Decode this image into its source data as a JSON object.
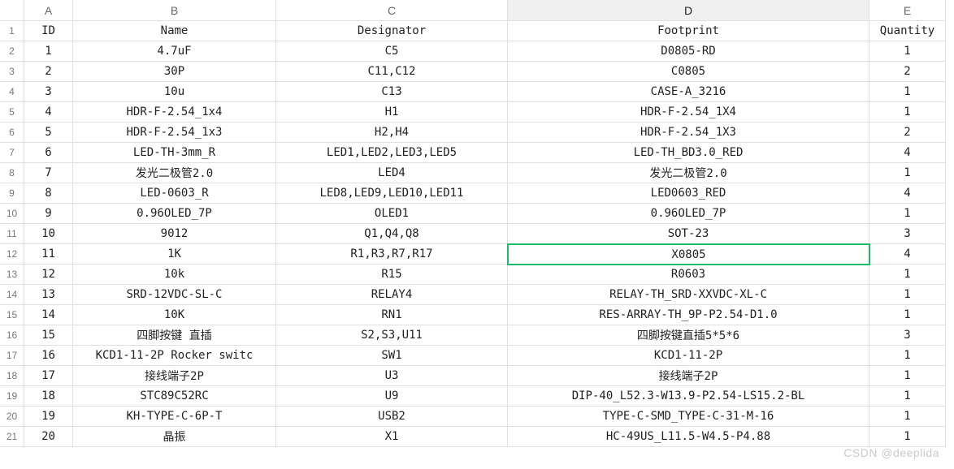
{
  "columns": [
    "A",
    "B",
    "C",
    "D",
    "E"
  ],
  "selectedColumn": "D",
  "activeCell": {
    "row": 11,
    "col": "D"
  },
  "headerRowIndex": 1,
  "headers": {
    "A": "ID",
    "B": "Name",
    "C": "Designator",
    "D": "Footprint",
    "E": "Quantity"
  },
  "rows": [
    {
      "id": "1",
      "name": "4.7uF",
      "designator": "C5",
      "footprint": "D0805-RD",
      "qty": "1"
    },
    {
      "id": "2",
      "name": "30P",
      "designator": "C11,C12",
      "footprint": "C0805",
      "qty": "2"
    },
    {
      "id": "3",
      "name": "10u",
      "designator": "C13",
      "footprint": "CASE-A_3216",
      "qty": "1"
    },
    {
      "id": "4",
      "name": "HDR-F-2.54_1x4",
      "designator": "H1",
      "footprint": "HDR-F-2.54_1X4",
      "qty": "1"
    },
    {
      "id": "5",
      "name": "HDR-F-2.54_1x3",
      "designator": "H2,H4",
      "footprint": "HDR-F-2.54_1X3",
      "qty": "2"
    },
    {
      "id": "6",
      "name": "LED-TH-3mm_R",
      "designator": "LED1,LED2,LED3,LED5",
      "footprint": "LED-TH_BD3.0_RED",
      "qty": "4"
    },
    {
      "id": "7",
      "name": "发光二极管2.0",
      "designator": "LED4",
      "footprint": "发光二极管2.0",
      "qty": "1"
    },
    {
      "id": "8",
      "name": "LED-0603_R",
      "designator": "LED8,LED9,LED10,LED11",
      "footprint": "LED0603_RED",
      "qty": "4"
    },
    {
      "id": "9",
      "name": "0.96OLED_7P",
      "designator": "OLED1",
      "footprint": "0.96OLED_7P",
      "qty": "1"
    },
    {
      "id": "10",
      "name": "9012",
      "designator": "Q1,Q4,Q8",
      "footprint": "SOT-23",
      "qty": "3"
    },
    {
      "id": "11",
      "name": "1K",
      "designator": "R1,R3,R7,R17",
      "footprint": "X0805",
      "qty": "4"
    },
    {
      "id": "12",
      "name": "10k",
      "designator": "R15",
      "footprint": "R0603",
      "qty": "1"
    },
    {
      "id": "13",
      "name": "SRD-12VDC-SL-C",
      "designator": "RELAY4",
      "footprint": "RELAY-TH_SRD-XXVDC-XL-C",
      "qty": "1"
    },
    {
      "id": "14",
      "name": "10K",
      "designator": "RN1",
      "footprint": "RES-ARRAY-TH_9P-P2.54-D1.0",
      "qty": "1"
    },
    {
      "id": "15",
      "name": "四脚按键 直插",
      "designator": "S2,S3,U11",
      "footprint": "四脚按键直插5*5*6",
      "qty": "3"
    },
    {
      "id": "16",
      "name": "KCD1-11-2P Rocker switc",
      "designator": "SW1",
      "footprint": "KCD1-11-2P",
      "qty": "1"
    },
    {
      "id": "17",
      "name": "接线端子2P",
      "designator": "U3",
      "footprint": "接线端子2P",
      "qty": "1"
    },
    {
      "id": "18",
      "name": "STC89C52RC",
      "designator": "U9",
      "footprint": "DIP-40_L52.3-W13.9-P2.54-LS15.2-BL",
      "qty": "1"
    },
    {
      "id": "19",
      "name": "KH-TYPE-C-6P-T",
      "designator": "USB2",
      "footprint": "TYPE-C-SMD_TYPE-C-31-M-16",
      "qty": "1"
    },
    {
      "id": "20",
      "name": "晶振",
      "designator": "X1",
      "footprint": "HC-49US_L11.5-W4.5-P4.88",
      "qty": "1"
    }
  ],
  "watermark": "CSDN @deeplida"
}
